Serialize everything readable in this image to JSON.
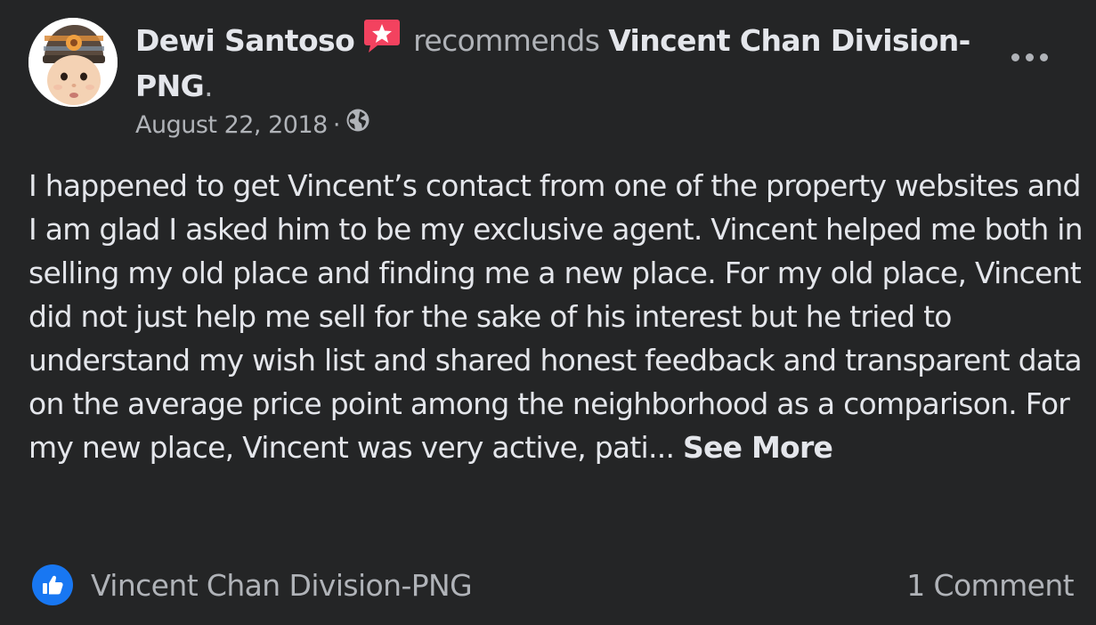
{
  "post": {
    "author": "Dewi Santoso",
    "action": "recommends",
    "page_name": "Vincent Chan Division-PNG",
    "period": ".",
    "date": "August 22, 2018",
    "separator": "·",
    "audience_icon": "globe-icon",
    "badge_icon": "recommendation-star-icon",
    "body_text": "I happened to get Vincent’s contact from one of the property websites and I am glad I asked him to be my exclusive agent. Vincent helped me both in selling my old place and finding me a new place. For my old place, Vincent did not just help me sell for the sake of his interest but he tried to understand my wish list and shared honest feedback and transparent data on the average price point among the neighborhood as a comparison. For my new place, Vincent was very active, pati...",
    "see_more_label": "See More"
  },
  "footer": {
    "reaction_icon": "thumbs-up-icon",
    "page_name": "Vincent Chan Division-PNG",
    "comment_count_label": "1 Comment"
  },
  "colors": {
    "background": "#242526",
    "primary_text": "#e4e6eb",
    "secondary_text": "#b0b3b8",
    "like_blue": "#1877f2",
    "badge_red": "#f3425f"
  }
}
